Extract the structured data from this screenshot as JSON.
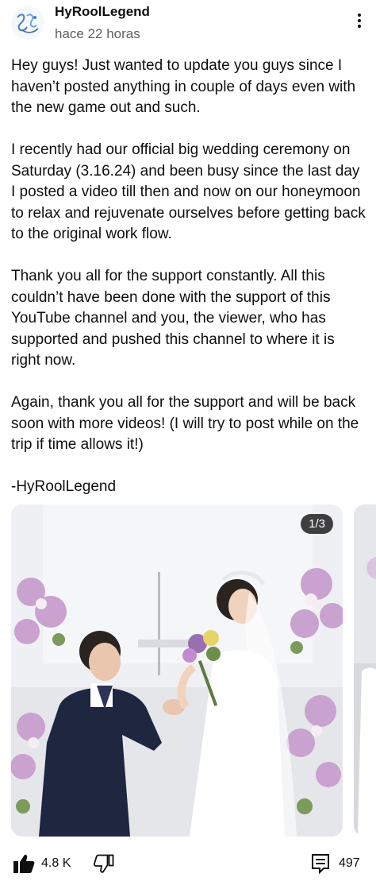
{
  "post": {
    "channel_name": "HyRoolLegend",
    "timestamp": "hace 22 horas",
    "paragraphs": [
      "Hey guys! Just wanted to update you guys since I haven’t posted anything in couple of days even with the new game out and such.",
      "I recently had our official big wedding ceremony on Saturday (3.16.24) and been busy since the last day I posted a video till then and now on our honeymoon to relax and rejuvenate ourselves before getting back to the original work flow.",
      "Thank you all for the support constantly. All this couldn’t have been done with the support of this YouTube channel and you, the viewer, who has supported and pushed this channel to where it is right now.",
      "Again, thank you all for the support and will be back soon with more videos! (I will try to post while on the trip if time allows it!)",
      "-HyRoolLegend"
    ]
  },
  "carousel": {
    "counter": "1/3"
  },
  "actions": {
    "like_count": "4.8 K",
    "comment_count": "497"
  },
  "icons": {
    "like": "thumbs-up-icon",
    "dislike": "thumbs-down-icon",
    "comment": "comment-icon",
    "menu": "more-vert-icon"
  }
}
